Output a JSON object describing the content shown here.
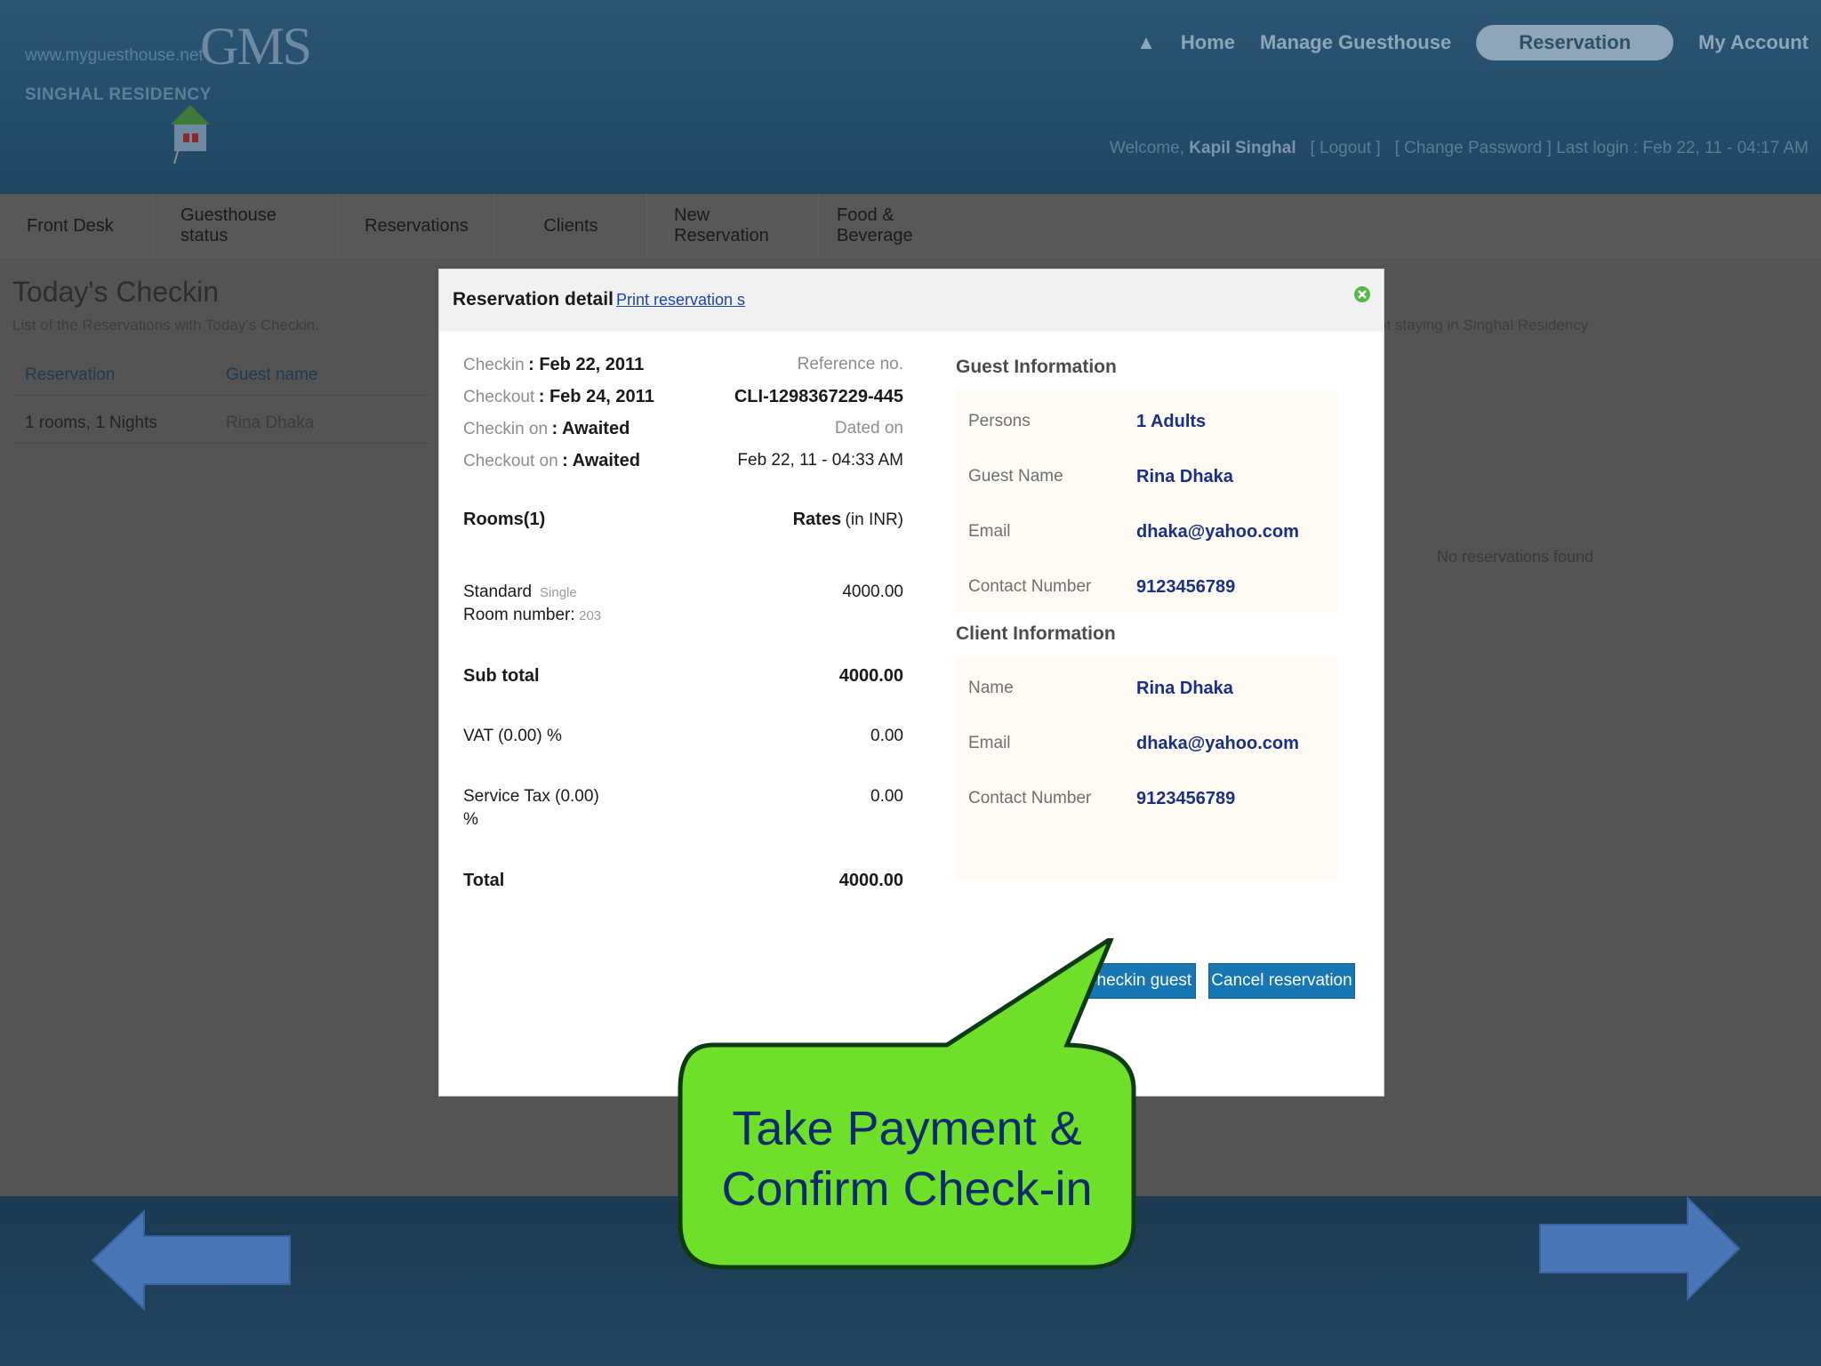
{
  "header": {
    "site_url": "www.myguesthouse.net",
    "logo": "GMS",
    "site_name": "SINGHAL RESIDENCY",
    "nav": [
      "Home",
      "Manage Guesthouse",
      "Reservation",
      "My Account"
    ],
    "active_nav": "Reservation",
    "welcome_prefix": "Welcome,",
    "user": "Kapil Singhal",
    "logout": "[ Logout ]",
    "change_password": "[ Change Password ]",
    "last_login": "Last login : Feb 22, 11 - 04:17 AM"
  },
  "menu": [
    "Front Desk",
    "Guesthouse status",
    "Reservations",
    "Clients",
    "New Reservation",
    "Food & Beverage"
  ],
  "background": {
    "title": "Today's Checkin",
    "subtitle": "List of the Reservations with Today's Checkin.",
    "right_subtitle": "nt staying in Singhal Residency",
    "table_headers": [
      "Reservation",
      "Guest name"
    ],
    "table_row": [
      "1 rooms, 1 Nights",
      "Rina Dhaka"
    ],
    "no_reservations": "No reservations found"
  },
  "modal": {
    "title": "Reservation detail",
    "print_link": "Print reservation s",
    "checkin_label": "Checkin",
    "checkin_value": ": Feb 22, 2011",
    "checkout_label": "Checkout",
    "checkout_value": ": Feb 24, 2011",
    "checkin_on_label": "Checkin on",
    "checkin_on_value": ": Awaited",
    "checkout_on_label": "Checkout on",
    "checkout_on_value": ": Awaited",
    "reference_label": "Reference no.",
    "reference_value": "CLI-1298367229-445",
    "dated_label": "Dated on",
    "dated_value": "Feb 22, 11 - 04:33 AM",
    "rooms_label": "Rooms(1)",
    "rates_label": "Rates",
    "rates_unit": "(in INR)",
    "room_type": "Standard",
    "room_subtype": "Single",
    "room_number_label": "Room number:",
    "room_number": "203",
    "room_rate": "4000.00",
    "subtotal_label": "Sub total",
    "subtotal_value": "4000.00",
    "vat_label": "VAT (0.00) %",
    "vat_value": "0.00",
    "service_tax_label": "Service Tax (0.00)",
    "service_tax_label2": "%",
    "service_tax_value": "0.00",
    "total_label": "Total",
    "total_value": "4000.00",
    "guest_info_title": "Guest Information",
    "guest_info": [
      {
        "label": "Persons",
        "value": "1 Adults"
      },
      {
        "label": "Guest Name",
        "value": "Rina Dhaka"
      },
      {
        "label": "Email",
        "value": "dhaka@yahoo.com"
      },
      {
        "label": "Contact Number",
        "value": "9123456789"
      }
    ],
    "client_info_title": "Client Information",
    "client_info": [
      {
        "label": "Name",
        "value": "Rina Dhaka"
      },
      {
        "label": "Email",
        "value": "dhaka@yahoo.com"
      },
      {
        "label": "Contact Number",
        "value": "9123456789"
      }
    ],
    "checkin_button": "Checkin guest",
    "cancel_button": "Cancel reservation"
  },
  "callout": {
    "line1": "Take Payment &",
    "line2": "Confirm Check-in",
    "fill": "#6ee02a"
  },
  "colors": {
    "header_bg": "#2b5674",
    "button_bg": "#1777b4",
    "value_blue": "#1b2f86",
    "arrow_blue": "#4a76b8"
  }
}
